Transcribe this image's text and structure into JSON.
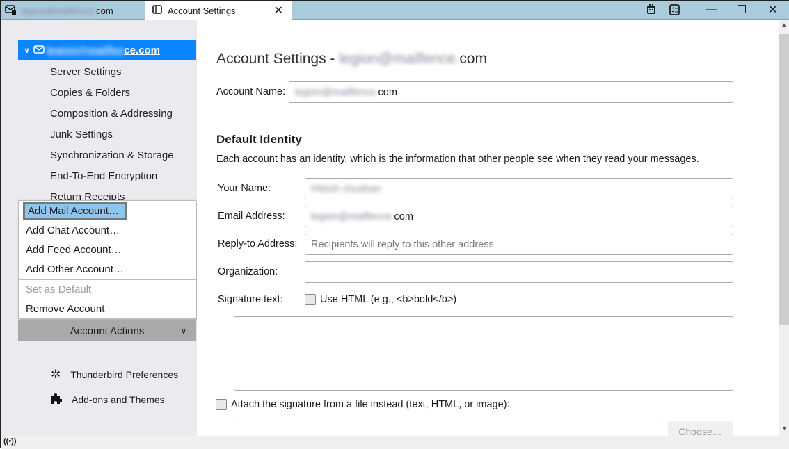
{
  "titlebar": {
    "tabs": [
      {
        "label_blurred": "legion@mailfence.",
        "label": "com",
        "icon": "mail-lock-icon"
      },
      {
        "label": "Account Settings",
        "icon": "settings-tab-icon",
        "active": true
      }
    ],
    "icons": [
      "calendar-icon",
      "tasks-icon",
      "minimize-icon",
      "maximize-icon",
      "close-icon"
    ]
  },
  "sidebar": {
    "account": {
      "blurred": "legion@mailfen",
      "visible": "ce.com"
    },
    "items": [
      "Server Settings",
      "Copies & Folders",
      "Composition & Addressing",
      "Junk Settings",
      "Synchronization & Storage",
      "End-To-End Encryption",
      "Return Receipts"
    ],
    "menu": [
      {
        "label": "Add Mail Account…",
        "highlighted": true
      },
      {
        "label": "Add Chat Account…"
      },
      {
        "label": "Add Feed Account…"
      },
      {
        "label": "Add Other Account…"
      },
      {
        "label": "Set as Default",
        "disabled": true
      },
      {
        "label": "Remove Account"
      }
    ],
    "actions_label": "Account Actions",
    "preferences": "Thunderbird Preferences",
    "addons": "Add-ons and Themes"
  },
  "main": {
    "title_prefix": "Account Settings - ",
    "title_blurred": "legion@mailfence.",
    "title_suffix": "com",
    "account_name_label": "Account Name:",
    "account_name_blurred": "legion@mailfence.",
    "account_name_suffix": "com",
    "identity_heading": "Default Identity",
    "identity_desc": "Each account has an identity, which is the information that other people see when they read your messages.",
    "your_name_label": "Your Name:",
    "your_name_blurred": "Hitesh chuahan",
    "email_label": "Email Address:",
    "email_blurred": "legion@mailfence.",
    "email_suffix": "com",
    "reply_label": "Reply-to Address:",
    "reply_placeholder": "Recipients will reply to this other address",
    "org_label": "Organization:",
    "org_value": "",
    "sig_label": "Signature text:",
    "use_html_label": "Use HTML (e.g., <b>bold</b>)",
    "use_html_checked": false,
    "attach_label": "Attach the signature from a file instead (text, HTML, or image):",
    "attach_checked": false,
    "choose_label": "Choose…"
  },
  "status": {
    "icon": "online-status-icon"
  }
}
